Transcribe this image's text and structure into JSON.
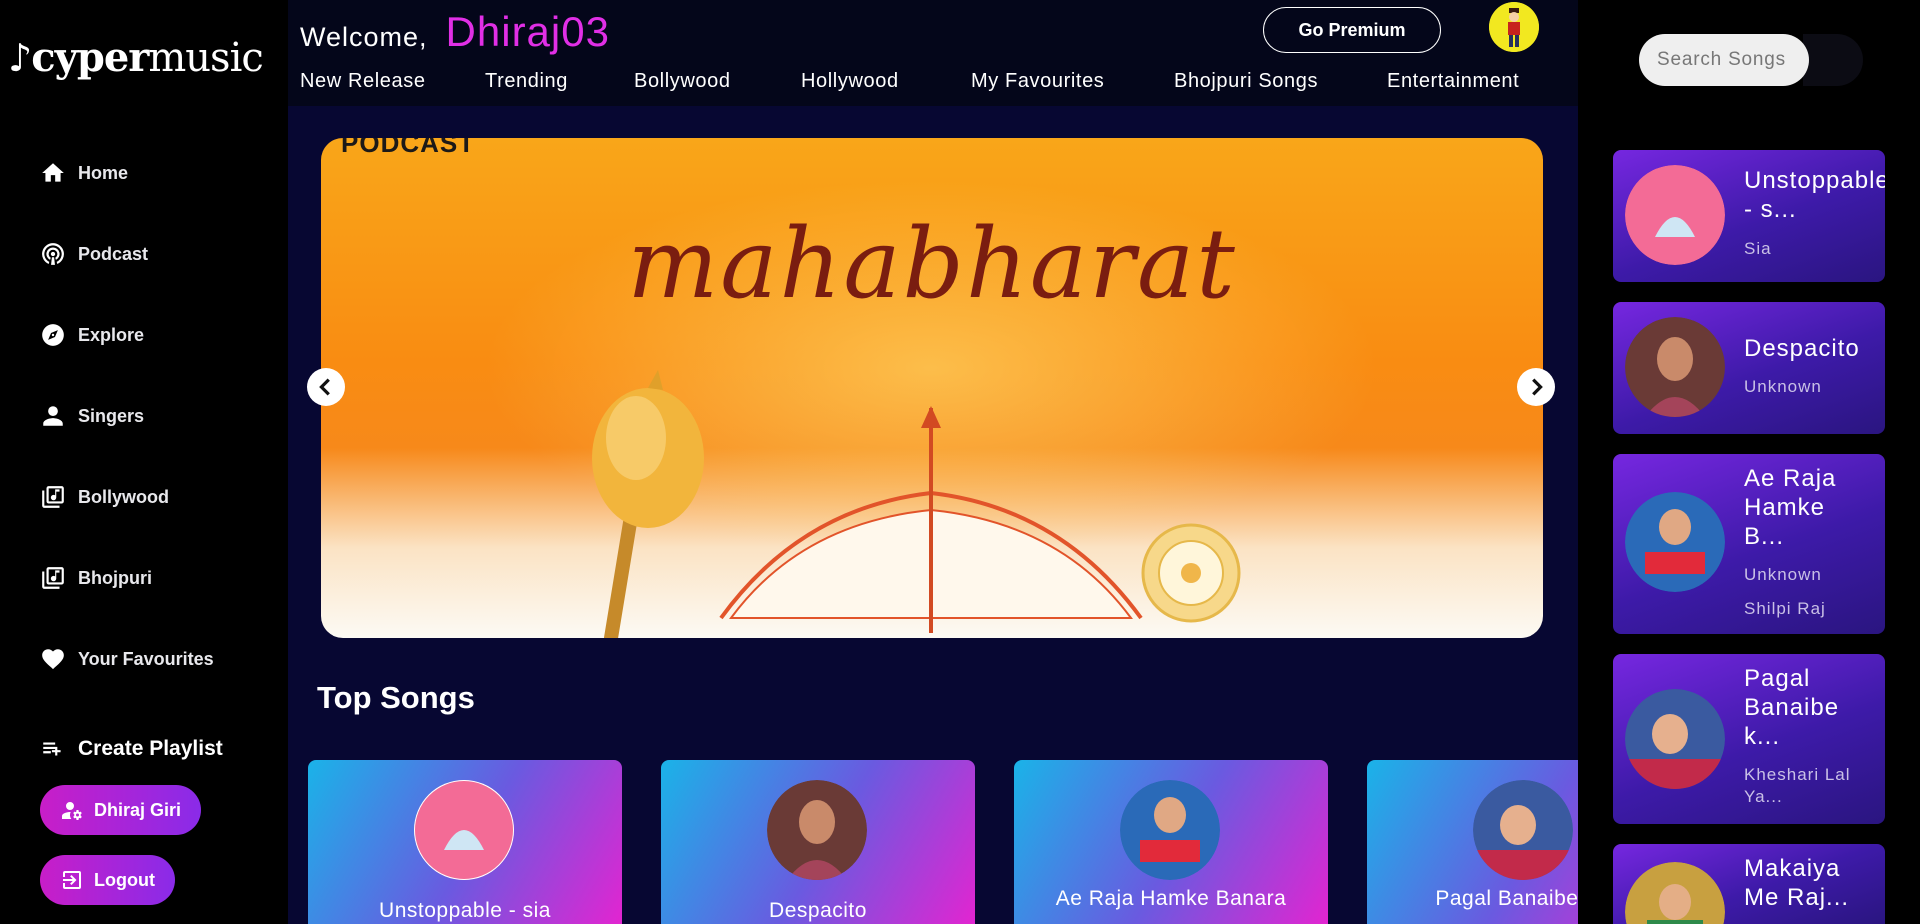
{
  "brand": {
    "logo_bold": "cyper",
    "logo_light": "music"
  },
  "sidebar": {
    "items": [
      {
        "label": "Home",
        "icon": "home-icon"
      },
      {
        "label": "Podcast",
        "icon": "podcast-icon"
      },
      {
        "label": "Explore",
        "icon": "compass-icon"
      },
      {
        "label": "Singers",
        "icon": "person-icon"
      },
      {
        "label": "Bollywood",
        "icon": "music-library-icon"
      },
      {
        "label": "Bhojpuri",
        "icon": "music-library-icon"
      },
      {
        "label": "Your Favourites",
        "icon": "heart-icon"
      }
    ],
    "create_playlist": "Create Playlist",
    "profile_button": "Dhiraj Giri",
    "logout_button": "Logout"
  },
  "header": {
    "welcome_label": "Welcome,",
    "username": "Dhiraj03",
    "premium_button": "Go Premium",
    "nav": [
      "New Release",
      "Trending",
      "Bollywood",
      "Hollywood",
      "My Favourites",
      "Bhojpuri Songs",
      "Entertainment"
    ]
  },
  "banner": {
    "tag": "PODCAST",
    "title": "mahabharat"
  },
  "top_songs": {
    "title": "Top Songs",
    "items": [
      {
        "name": "Unstoppable - sia"
      },
      {
        "name": "Despacito"
      },
      {
        "name": "Ae Raja Hamke Banara"
      },
      {
        "name": "Pagal Banaibe Re"
      }
    ]
  },
  "search": {
    "placeholder": "Search Songs"
  },
  "right_panel": {
    "items": [
      {
        "title_lines": [
          "Unstoppable",
          "- s..."
        ],
        "subs": [
          "Sia"
        ]
      },
      {
        "title_lines": [
          "Despacito"
        ],
        "subs": [
          "Unknown"
        ]
      },
      {
        "title_lines": [
          "Ae Raja",
          "Hamke",
          "B..."
        ],
        "subs": [
          "Unknown",
          "Shilpi Raj"
        ]
      },
      {
        "title_lines": [
          "Pagal",
          "Banaibe",
          "k..."
        ],
        "subs": [
          "Kheshari Lal",
          "Ya..."
        ]
      },
      {
        "title_lines": [
          "Makaiya",
          "Me Raj..."
        ],
        "subs": []
      }
    ]
  },
  "colors": {
    "accent_pink": "#e12fe6",
    "sidebar_bg": "#000000",
    "main_bg": "#070732",
    "avatar_bg": "#f2e820"
  }
}
